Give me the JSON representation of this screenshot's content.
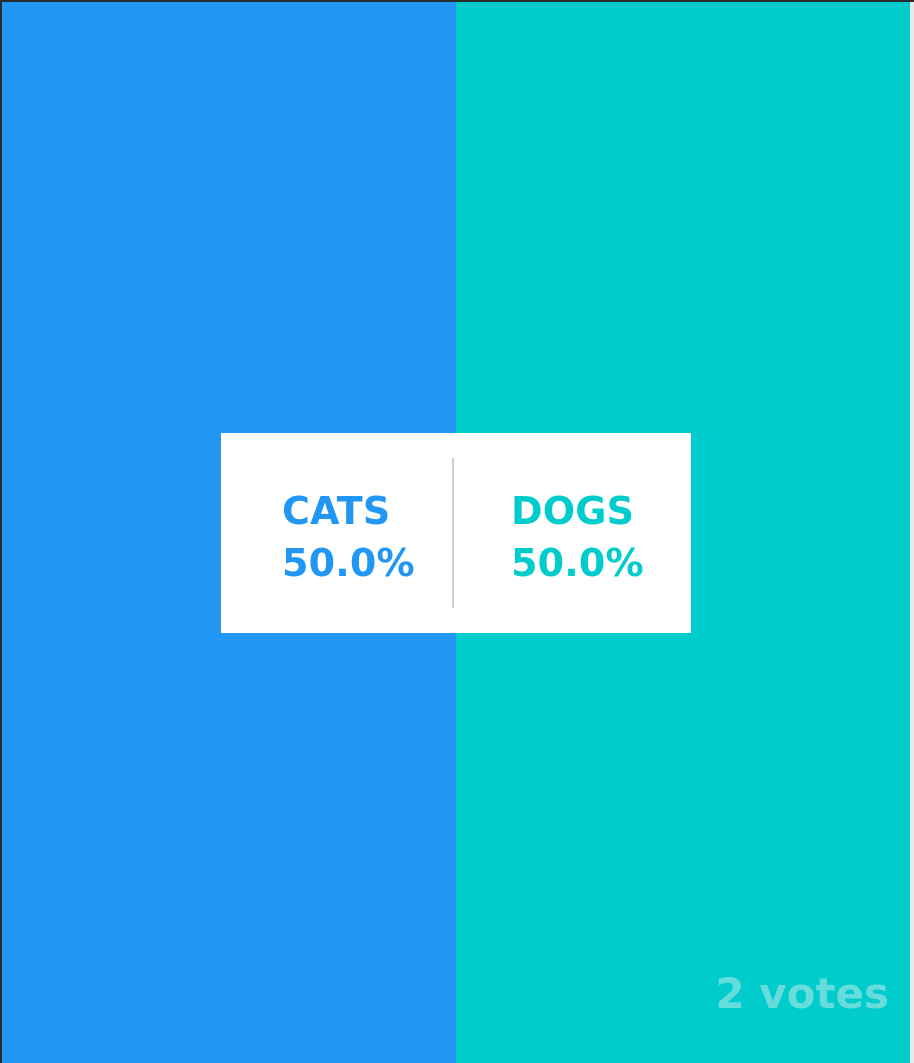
{
  "poll": {
    "options": [
      {
        "label": "CATS",
        "percent_text": "50.0%",
        "share": 0.5,
        "color": "#2196f3"
      },
      {
        "label": "DOGS",
        "percent_text": "50.0%",
        "share": 0.5,
        "color": "#00cccc"
      }
    ],
    "votes_text": "2 votes"
  }
}
